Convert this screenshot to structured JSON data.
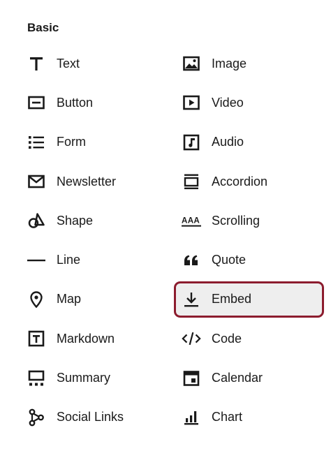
{
  "section": {
    "title": "Basic"
  },
  "blocks": [
    {
      "label": "Text",
      "icon": "text-icon"
    },
    {
      "label": "Image",
      "icon": "image-icon"
    },
    {
      "label": "Button",
      "icon": "button-icon"
    },
    {
      "label": "Video",
      "icon": "video-icon"
    },
    {
      "label": "Form",
      "icon": "form-icon"
    },
    {
      "label": "Audio",
      "icon": "audio-icon"
    },
    {
      "label": "Newsletter",
      "icon": "newsletter-icon"
    },
    {
      "label": "Accordion",
      "icon": "accordion-icon"
    },
    {
      "label": "Shape",
      "icon": "shape-icon"
    },
    {
      "label": "Scrolling",
      "icon": "scrolling-icon",
      "icon_text": "AAA"
    },
    {
      "label": "Line",
      "icon": "line-icon"
    },
    {
      "label": "Quote",
      "icon": "quote-icon"
    },
    {
      "label": "Map",
      "icon": "map-pin-icon"
    },
    {
      "label": "Embed",
      "icon": "embed-download-icon",
      "highlighted": true
    },
    {
      "label": "Markdown",
      "icon": "markdown-icon"
    },
    {
      "label": "Code",
      "icon": "code-icon"
    },
    {
      "label": "Summary",
      "icon": "summary-icon"
    },
    {
      "label": "Calendar",
      "icon": "calendar-icon"
    },
    {
      "label": "Social Links",
      "icon": "social-links-icon"
    },
    {
      "label": "Chart",
      "icon": "chart-icon"
    }
  ],
  "colors": {
    "highlight_border": "#8c1c2e",
    "highlight_bg": "#eeeeee",
    "text": "#1a1a1a"
  }
}
